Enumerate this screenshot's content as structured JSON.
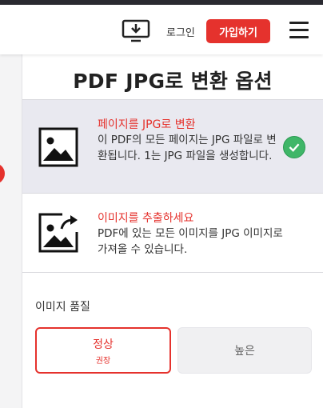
{
  "header": {
    "download_icon": "desktop-download-icon",
    "login_label": "로그인",
    "signup_label": "가입하기",
    "menu_icon": "hamburger-menu-icon"
  },
  "panel": {
    "title": "PDF JPG로 변환 옵션"
  },
  "options": [
    {
      "icon": "image-icon",
      "title": "페이지를 JPG로 변환",
      "description": "이 PDF의 모든 페이지는 JPG 파일로 변환됩니다. 1는 JPG 파일을 생성합니다.",
      "selected": true
    },
    {
      "icon": "image-export-icon",
      "title": "이미지를 추출하세요",
      "description": "PDF에 있는 모든 이미지를 JPG 이미지로 가져올 수 있습니다.",
      "selected": false
    }
  ],
  "quality": {
    "label": "이미지 품질",
    "options": [
      {
        "label": "정상",
        "sublabel": "권장",
        "selected": true
      },
      {
        "label": "높은",
        "selected": false
      }
    ]
  },
  "colors": {
    "accent": "#e5322d",
    "success": "#3fb668",
    "selected_bg": "#e9e9f0"
  }
}
